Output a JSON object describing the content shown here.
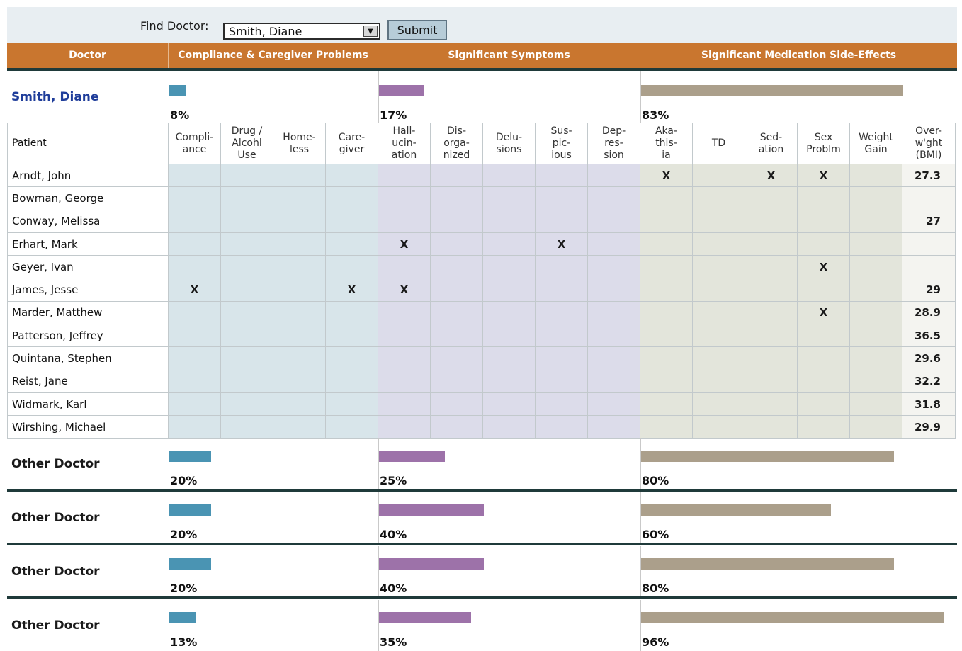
{
  "find": {
    "label": "Find Doctor:",
    "selected": "Smith, Diane",
    "submit_label": "Submit"
  },
  "headers": {
    "doctor": "Doctor",
    "compliance": "Compliance & Caregiver Problems",
    "symptoms": "Significant Symptoms",
    "side_effects": "Significant Medication Side-Effects"
  },
  "colors": {
    "compliance": "#4a94b3",
    "symptoms": "#9d72a9",
    "side_effects": "#ab9f8b",
    "header": "#c9762f",
    "selected_doctor": "#1f3d9a"
  },
  "current_doctor": {
    "name": "Smith, Diane",
    "compliance": {
      "value": 0.08,
      "label": "8%"
    },
    "symptoms": {
      "value": 0.17,
      "label": "17%"
    },
    "side_effects": {
      "value": 0.83,
      "label": "83%"
    }
  },
  "columns": [
    {
      "key": "patient",
      "label": "Patient"
    },
    {
      "key": "compliance",
      "label": "Compli-\nance"
    },
    {
      "key": "drug",
      "label": "Drug /\nAlcohl\nUse"
    },
    {
      "key": "homeless",
      "label": "Home-\nless"
    },
    {
      "key": "caregiver",
      "label": "Care-\ngiver"
    },
    {
      "key": "hallucination",
      "label": "Hall-\nucin-\nation"
    },
    {
      "key": "disorganized",
      "label": "Dis-\norga-\nnized"
    },
    {
      "key": "delusions",
      "label": "Delu-\nsions"
    },
    {
      "key": "suspicious",
      "label": "Sus-\npic-\nious"
    },
    {
      "key": "depression",
      "label": "Dep-\nres-\nsion"
    },
    {
      "key": "akathisia",
      "label": "Aka-\nthis-\nia"
    },
    {
      "key": "td",
      "label": "TD"
    },
    {
      "key": "sedation",
      "label": "Sed-\nation"
    },
    {
      "key": "sex",
      "label": "Sex\nProblm"
    },
    {
      "key": "weight",
      "label": "Weight\nGain"
    },
    {
      "key": "bmi",
      "label": "Over-\nw'ght\n(BMI)"
    }
  ],
  "patients": [
    {
      "name": "Arndt, John",
      "marks": [
        "",
        "",
        "",
        "",
        "",
        "",
        "",
        "",
        "",
        "X",
        "",
        "X",
        "X",
        ""
      ],
      "bmi": "27.3"
    },
    {
      "name": "Bowman, George",
      "marks": [
        "",
        "",
        "",
        "",
        "",
        "",
        "",
        "",
        "",
        "",
        "",
        "",
        "",
        ""
      ],
      "bmi": ""
    },
    {
      "name": "Conway, Melissa",
      "marks": [
        "",
        "",
        "",
        "",
        "",
        "",
        "",
        "",
        "",
        "",
        "",
        "",
        "",
        ""
      ],
      "bmi": "27"
    },
    {
      "name": "Erhart, Mark",
      "marks": [
        "",
        "",
        "",
        "",
        "X",
        "",
        "",
        "X",
        "",
        "",
        "",
        "",
        "",
        ""
      ],
      "bmi": ""
    },
    {
      "name": "Geyer, Ivan",
      "marks": [
        "",
        "",
        "",
        "",
        "",
        "",
        "",
        "",
        "",
        "",
        "",
        "",
        "X",
        ""
      ],
      "bmi": ""
    },
    {
      "name": "James, Jesse",
      "marks": [
        "X",
        "",
        "",
        "X",
        "X",
        "",
        "",
        "",
        "",
        "",
        "",
        "",
        "",
        ""
      ],
      "bmi": "29"
    },
    {
      "name": "Marder, Matthew",
      "marks": [
        "",
        "",
        "",
        "",
        "",
        "",
        "",
        "",
        "",
        "",
        "",
        "",
        "X",
        ""
      ],
      "bmi": "28.9"
    },
    {
      "name": "Patterson, Jeffrey",
      "marks": [
        "",
        "",
        "",
        "",
        "",
        "",
        "",
        "",
        "",
        "",
        "",
        "",
        "",
        ""
      ],
      "bmi": "36.5"
    },
    {
      "name": "Quintana, Stephen",
      "marks": [
        "",
        "",
        "",
        "",
        "",
        "",
        "",
        "",
        "",
        "",
        "",
        "",
        "",
        ""
      ],
      "bmi": "29.6"
    },
    {
      "name": "Reist, Jane",
      "marks": [
        "",
        "",
        "",
        "",
        "",
        "",
        "",
        "",
        "",
        "",
        "",
        "",
        "",
        ""
      ],
      "bmi": "32.2"
    },
    {
      "name": "Widmark, Karl",
      "marks": [
        "",
        "",
        "",
        "",
        "",
        "",
        "",
        "",
        "",
        "",
        "",
        "",
        "",
        ""
      ],
      "bmi": "31.8"
    },
    {
      "name": "Wirshing, Michael",
      "marks": [
        "",
        "",
        "",
        "",
        "",
        "",
        "",
        "",
        "",
        "",
        "",
        "",
        "",
        ""
      ],
      "bmi": "29.9"
    }
  ],
  "other_doctors": [
    {
      "name": "Other Doctor",
      "compliance": {
        "value": 0.2,
        "label": "20%"
      },
      "symptoms": {
        "value": 0.25,
        "label": "25%"
      },
      "side_effects": {
        "value": 0.8,
        "label": "80%"
      }
    },
    {
      "name": "Other Doctor",
      "compliance": {
        "value": 0.2,
        "label": "20%"
      },
      "symptoms": {
        "value": 0.4,
        "label": "40%"
      },
      "side_effects": {
        "value": 0.6,
        "label": "60%"
      }
    },
    {
      "name": "Other Doctor",
      "compliance": {
        "value": 0.2,
        "label": "20%"
      },
      "symptoms": {
        "value": 0.4,
        "label": "40%"
      },
      "side_effects": {
        "value": 0.8,
        "label": "80%"
      }
    },
    {
      "name": "Other Doctor",
      "compliance": {
        "value": 0.13,
        "label": "13%"
      },
      "symptoms": {
        "value": 0.35,
        "label": "35%"
      },
      "side_effects": {
        "value": 0.96,
        "label": "96%"
      }
    }
  ]
}
